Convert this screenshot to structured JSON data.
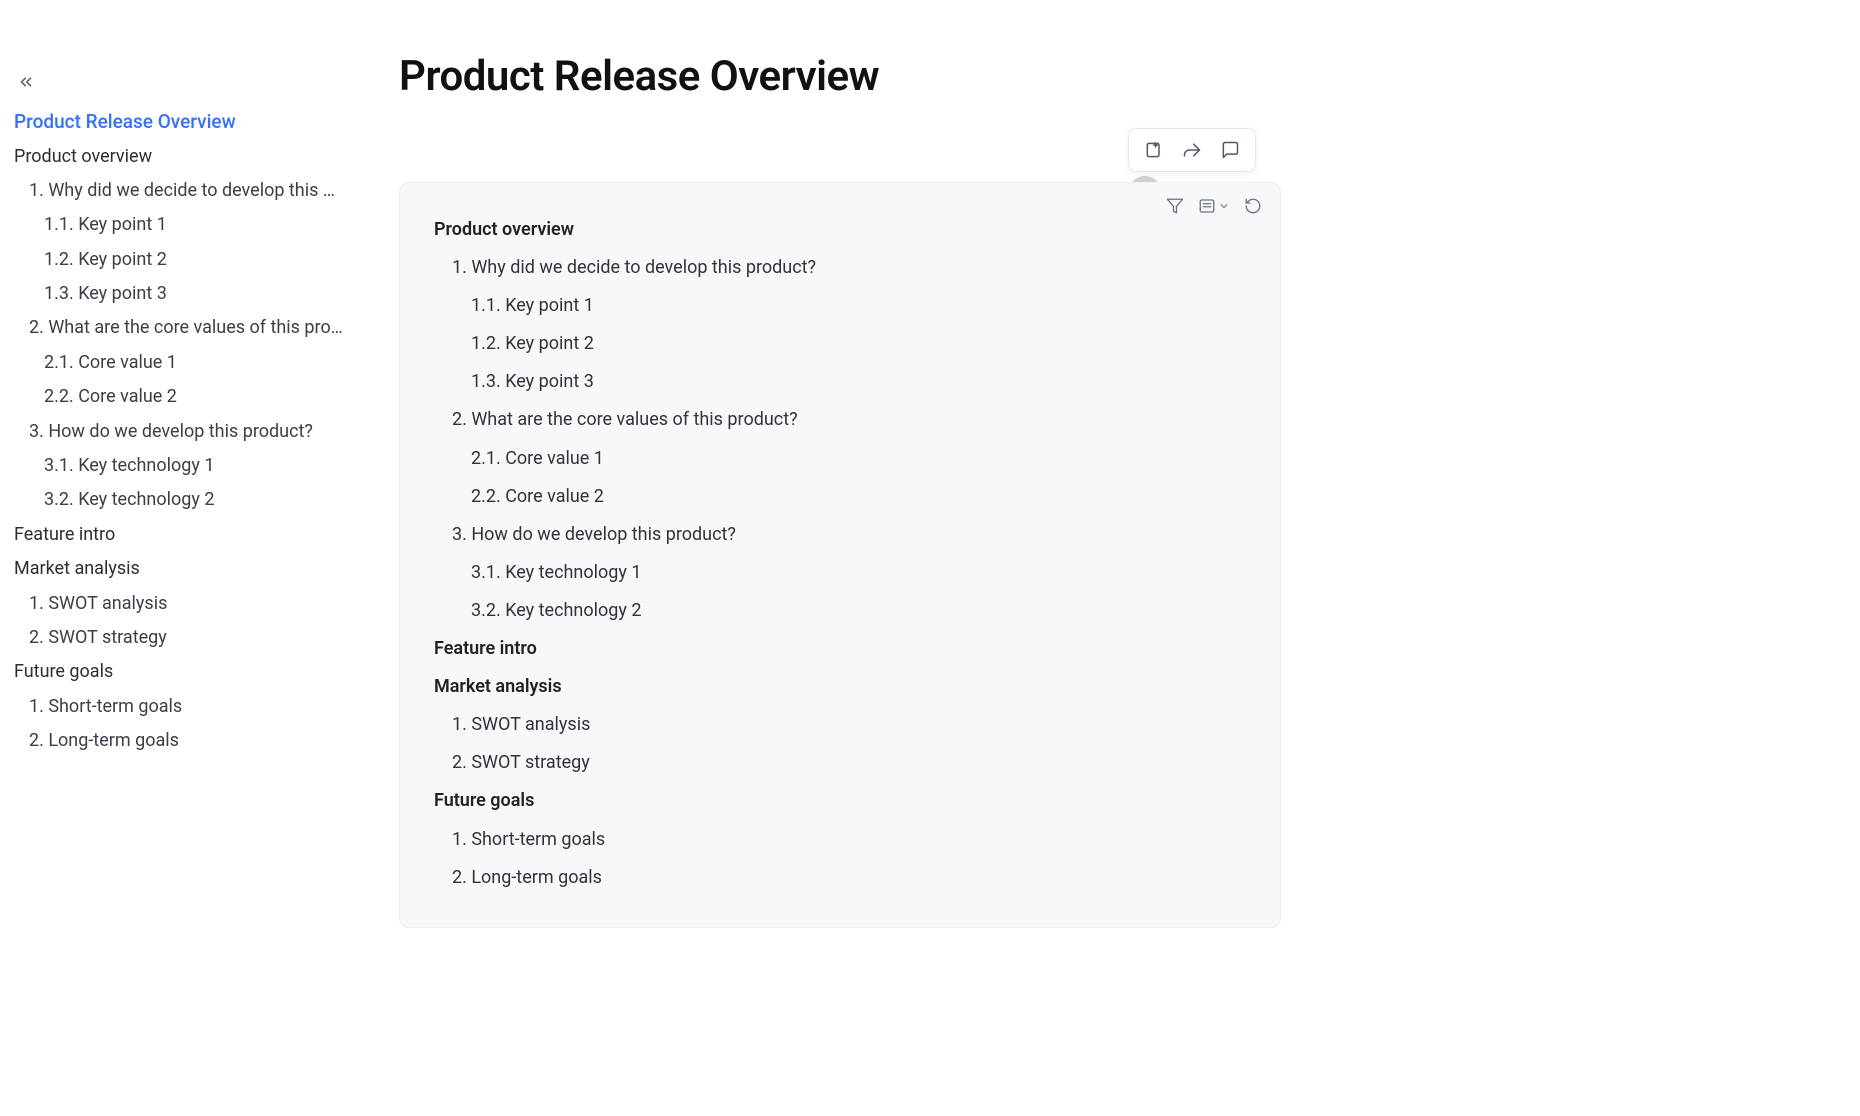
{
  "page": {
    "title": "Product Release Overview"
  },
  "sidebar": {
    "doc_title": "Product Release Overview",
    "items": [
      {
        "level": 0,
        "text": "Product overview"
      },
      {
        "level": 1,
        "text": "1. Why did we decide to develop this pro..."
      },
      {
        "level": 2,
        "text": "1.1. Key point 1"
      },
      {
        "level": 2,
        "text": "1.2. Key point 2"
      },
      {
        "level": 2,
        "text": "1.3. Key point 3"
      },
      {
        "level": 1,
        "text": "2. What are the core values of this produ..."
      },
      {
        "level": 2,
        "text": "2.1. Core value 1"
      },
      {
        "level": 2,
        "text": "2.2. Core value 2"
      },
      {
        "level": 1,
        "text": "3. How do we develop this product?"
      },
      {
        "level": 2,
        "text": "3.1. Key technology 1"
      },
      {
        "level": 2,
        "text": "3.2. Key technology 2"
      },
      {
        "level": 0,
        "text": "Feature intro"
      },
      {
        "level": 0,
        "text": "Market analysis"
      },
      {
        "level": 1,
        "text": "1. SWOT analysis"
      },
      {
        "level": 1,
        "text": "2. SWOT strategy"
      },
      {
        "level": 0,
        "text": "Future goals"
      },
      {
        "level": 1,
        "text": "1. Short-term goals"
      },
      {
        "level": 1,
        "text": "2. Long-term goals"
      }
    ]
  },
  "toc": {
    "rows": [
      {
        "level": 0,
        "text": "Product overview"
      },
      {
        "level": 1,
        "text": "1. Why did we decide to develop this product?"
      },
      {
        "level": 2,
        "text": "1.1. Key point 1"
      },
      {
        "level": 2,
        "text": "1.2. Key point 2"
      },
      {
        "level": 2,
        "text": "1.3. Key point 3"
      },
      {
        "level": 1,
        "text": "2. What are the core values of this product?"
      },
      {
        "level": 2,
        "text": "2.1. Core value 1"
      },
      {
        "level": 2,
        "text": "2.2. Core value 2"
      },
      {
        "level": 1,
        "text": "3. How do we develop this product?"
      },
      {
        "level": 2,
        "text": "3.1. Key technology 1"
      },
      {
        "level": 2,
        "text": "3.2. Key technology 2"
      },
      {
        "level": 0,
        "text": "Feature intro"
      },
      {
        "level": 0,
        "text": "Market analysis"
      },
      {
        "level": 1,
        "text": "1. SWOT analysis"
      },
      {
        "level": 1,
        "text": "2. SWOT strategy"
      },
      {
        "level": 0,
        "text": "Future goals"
      },
      {
        "level": 1,
        "text": "1. Short-term goals"
      },
      {
        "level": 1,
        "text": "2. Long-term goals"
      }
    ]
  }
}
